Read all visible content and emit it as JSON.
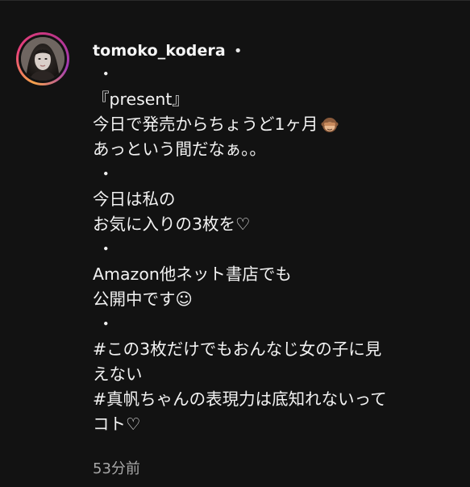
{
  "comment": {
    "username": "tomoko_kodera",
    "separator": "•",
    "caption_lines": [
      {
        "text": "・",
        "kind": "dot"
      },
      {
        "text": "『present』",
        "kind": "text"
      },
      {
        "text": "今日で発売からちょうど1ヶ月",
        "kind": "text",
        "trail_icon": "see-no-evil-monkey-emoji"
      },
      {
        "text": "あっという間だなぁ。。",
        "kind": "text"
      },
      {
        "text": "・",
        "kind": "dot"
      },
      {
        "text": "今日は私の",
        "kind": "text"
      },
      {
        "text": "お気に入りの3枚を♡",
        "kind": "text"
      },
      {
        "text": "・",
        "kind": "dot"
      },
      {
        "text": "Amazon他ネット書店でも",
        "kind": "text"
      },
      {
        "text": "公開中です☺",
        "kind": "text"
      },
      {
        "text": "・",
        "kind": "dot"
      },
      {
        "text": "#この3枚だけでもおんなじ女の子に見",
        "kind": "hashtag"
      },
      {
        "text": "えない",
        "kind": "hashtag"
      },
      {
        "text": "#真帆ちゃんの表現力は底知れないって",
        "kind": "hashtag"
      },
      {
        "text": "コト♡",
        "kind": "hashtag"
      }
    ],
    "timestamp": "53分前"
  },
  "colors": {
    "background": "#121212",
    "text": "#f2f2f2",
    "muted": "#a8a8a8"
  }
}
